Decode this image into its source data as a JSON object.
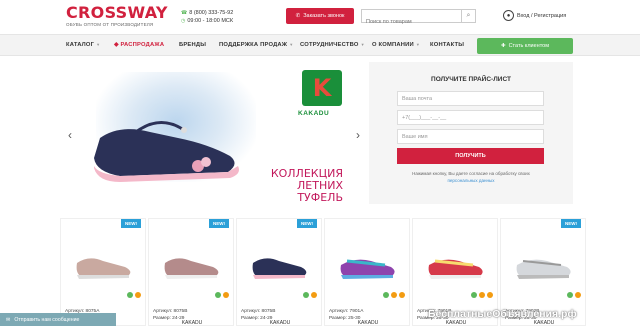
{
  "header": {
    "logo": "CROSSWAY",
    "logo_tagline": "ОБУВЬ ОПТОМ ОТ ПРОИЗВОДИТЕЛЯ",
    "phone": "8 (800) 333-75-92",
    "hours": "09:00 - 18:00 МСК",
    "callback_label": "Заказать звонок",
    "search_placeholder": "Поиск по товарам",
    "login_label": "Вход / Регистрация"
  },
  "nav": {
    "items": [
      "КАТАЛОГ",
      "РАСПРОДАЖА",
      "БРЕНДЫ",
      "ПОДДЕРЖКА ПРОДАЖ",
      "СОТРУДНИЧЕСТВО",
      "О КОМПАНИИ",
      "КОНТАКТЫ"
    ],
    "partner_button": "Стать клиентом"
  },
  "banner": {
    "brand": "KAKADU",
    "collection_line1": "КОЛЛЕКЦИЯ",
    "collection_line2": "ЛЕТНИХ ТУФЕЛЬ"
  },
  "form": {
    "title": "ПОЛУЧИТЕ ПРАЙС-ЛИСТ",
    "name_placeholder": "Ваша почта",
    "phone_placeholder": "+7(___)___-__-__",
    "email_placeholder": "Ваше имя",
    "submit_label": "ПОЛУЧИТЬ",
    "consent_text": "Нажимая кнопку, Вы даете согласие на обработку своих",
    "consent_link": "персональных данных"
  },
  "products": [
    {
      "badge": "NEW!",
      "article": "Артикул: 8075A",
      "size": "Размер: 21-26",
      "brand": ""
    },
    {
      "badge": "NEW!",
      "article": "Артикул: 8075B",
      "size": "Размер: 24-29",
      "brand": "KAKADU"
    },
    {
      "badge": "NEW!",
      "article": "Артикул: 8075B",
      "size": "Размер: 24-29",
      "brand": "KAKADU"
    },
    {
      "badge": "",
      "article": "Артикул: 7901A",
      "size": "Размер: 25-30",
      "brand": "KAKADU"
    },
    {
      "badge": "",
      "article": "Артикул: 7901B",
      "size": "Размер: 25-30",
      "brand": "KAKADU"
    },
    {
      "badge": "NEW!",
      "article": "Артикул: 7902B",
      "size": "Размер: 25-30",
      "brand": "KAKADU"
    }
  ],
  "chat_label": "Отправить нам сообщение",
  "watermark": "БесплатныеОбъявления.рф",
  "colors": {
    "accent": "#d1213e",
    "green": "#5cb85c",
    "new_badge": "#2ba0d8"
  }
}
